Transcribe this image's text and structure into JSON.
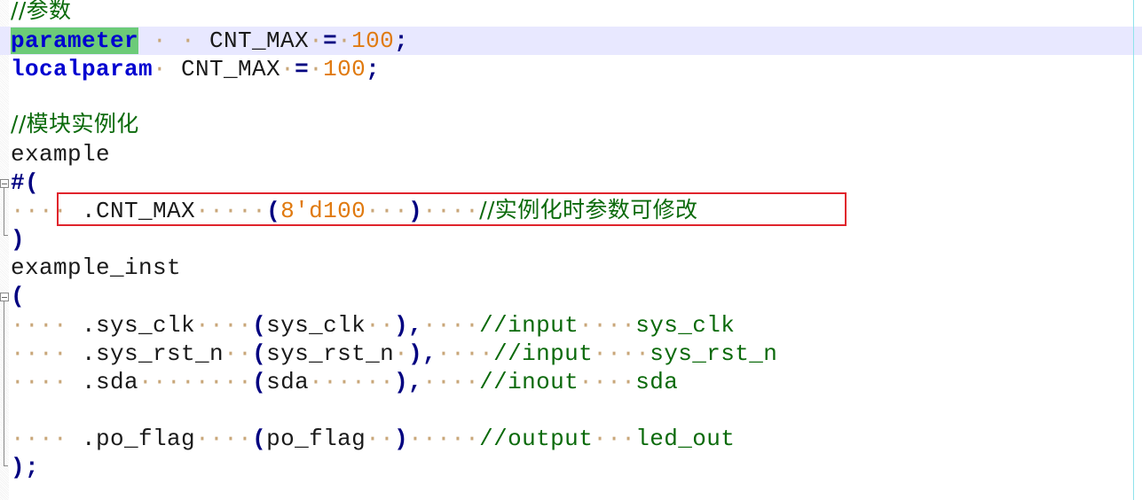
{
  "editor": {
    "language": "verilog",
    "lines": {
      "c1": "//参数",
      "l2_kw": "parameter",
      "l2_rest_ws": " · ",
      "l2_name": "CNT_MAX",
      "l2_eq": "=",
      "l2_val": "100",
      "l2_semi": ";",
      "l3_kw": "localparam",
      "l3_name": "CNT_MAX",
      "l3_eq": "=",
      "l3_val": "100",
      "l3_semi": ";",
      "c5": "//模块实例化",
      "l6": "example",
      "l7": "#(",
      "l8_port": ".CNT_MAX",
      "l8_open": "(",
      "l8_val": "8'd100",
      "l8_close": ")",
      "l8_cmt": "//实例化时参数可修改",
      "l9": ")",
      "l10": "example_inst",
      "l11": "(",
      "l12_port": ".sys_clk",
      "l12_sig": "sys_clk",
      "l12_cmt": "//input",
      "l12_name": "sys_clk",
      "l13_port": ".sys_rst_n",
      "l13_sig": "sys_rst_n",
      "l13_cmt": "//input",
      "l13_name": "sys_rst_n",
      "l14_port": ".sda",
      "l14_sig": "sda",
      "l14_cmt": "//inout",
      "l14_name": "sda",
      "l16_port": ".po_flag",
      "l16_sig": "po_flag",
      "l16_cmt": "//output",
      "l16_name": "led_out",
      "l17": ");",
      "paren_open": "(",
      "paren_close_comma": "),",
      "paren_close": ")"
    },
    "colors": {
      "keyword": "#0000d0",
      "number": "#e07a10",
      "comment": "#0b6a0b",
      "current_line": "#e8e8ff",
      "keyword_highlight": "#6ccb78",
      "annotation_box": "#e0242c"
    }
  }
}
